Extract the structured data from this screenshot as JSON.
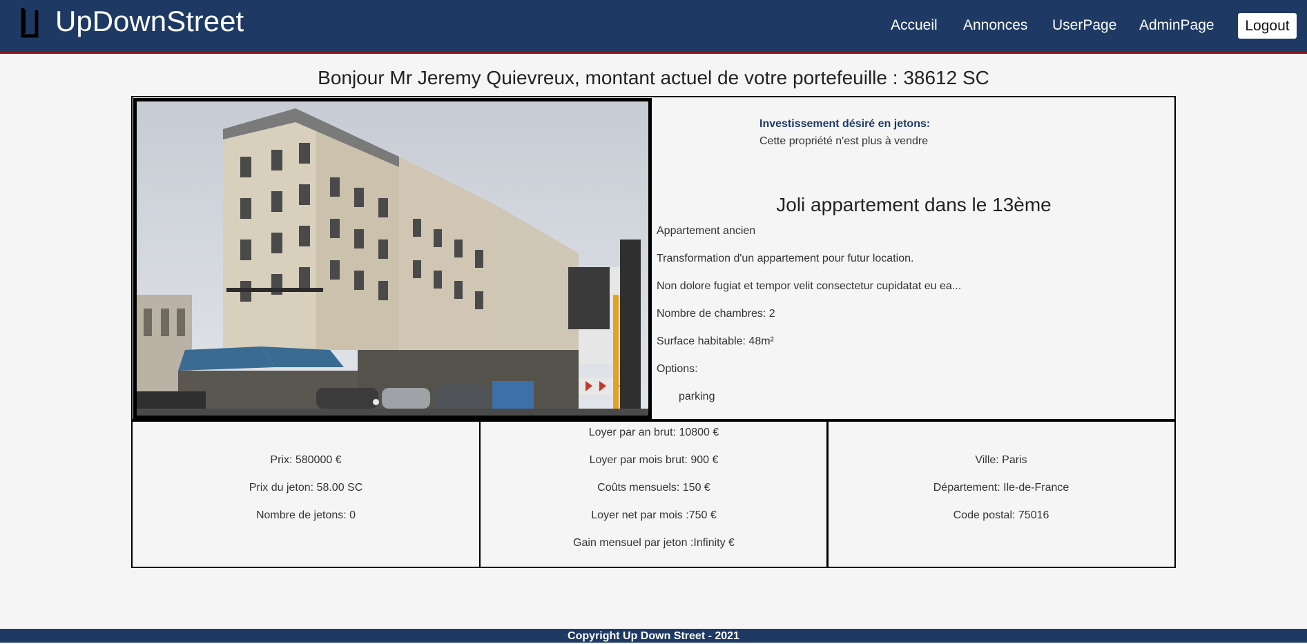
{
  "header": {
    "brand": "UpDownStreet",
    "nav": [
      "Accueil",
      "Annonces",
      "UserPage",
      "AdminPage"
    ],
    "logout_label": "Logout"
  },
  "greeting": "Bonjour Mr Jeremy Quievreux, montant actuel de votre portefeuille : 38612 SC",
  "property": {
    "invest_label": "Investissement désiré en jetons:",
    "invest_status": "Cette propriété n'est plus à vendre",
    "title": "Joli appartement dans le 13ème",
    "type": "Appartement ancien",
    "summary": "Transformation d'un appartement pour futur location.",
    "description": "Non dolore fugiat et tempor velit consectetur cupidatat eu ea...",
    "rooms": "Nombre de chambres: 2",
    "surface": "Surface habitable: 48m²",
    "options_label": "Options:",
    "options": [
      "parking"
    ],
    "image_alt": "Immeuble haussmannien à Paris"
  },
  "pricing": {
    "price": "Prix: 580000 €",
    "token_price": "Prix du jeton: 58.00 SC",
    "token_count": "Nombre de jetons: 0"
  },
  "rent": {
    "yearly_gross": "Loyer par an brut: 10800 €",
    "monthly_gross": "Loyer par mois brut: 900 €",
    "monthly_costs": "Coûts mensuels: 150 €",
    "monthly_net": "Loyer net par mois :750 €",
    "gain_per_token": "Gain mensuel par jeton :Infinity €"
  },
  "location": {
    "city": "Ville: Paris",
    "department": "Département: Ile-de-France",
    "postal_code": "Code postal: 75016"
  },
  "footer": "Copyright Up Down Street - 2021",
  "colors": {
    "navbar": "#1e3a64",
    "navbar_border": "#8b1a1a",
    "background": "#f5f5f5"
  }
}
